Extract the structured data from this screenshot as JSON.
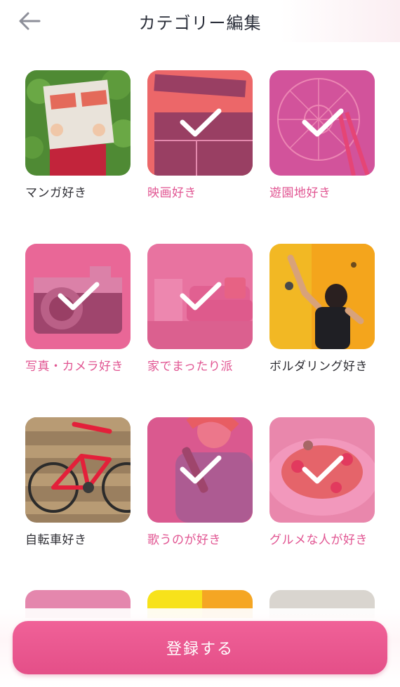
{
  "header": {
    "title": "カテゴリー編集",
    "back_icon": "arrow-left-icon"
  },
  "categories": [
    {
      "label": "マンガ好き",
      "selected": false,
      "image": "comic-book-photo"
    },
    {
      "label": "映画好き",
      "selected": true,
      "image": "clapperboard-photo"
    },
    {
      "label": "遊園地好き",
      "selected": true,
      "image": "ferris-wheel-photo"
    },
    {
      "label": "写真・カメラ好き",
      "selected": true,
      "image": "camera-photo"
    },
    {
      "label": "家でまったり派",
      "selected": true,
      "image": "living-room-photo"
    },
    {
      "label": "ボルダリング好き",
      "selected": false,
      "image": "climbing-wall-photo"
    },
    {
      "label": "自転車好き",
      "selected": false,
      "image": "red-bicycle-photo"
    },
    {
      "label": "歌うのが好き",
      "selected": true,
      "image": "singer-microphone-photo"
    },
    {
      "label": "グルメな人が好き",
      "selected": true,
      "image": "pasta-dish-photo"
    }
  ],
  "footer": {
    "submit_label": "登録する"
  },
  "colors": {
    "accent": "#e94e8c",
    "selected_label": "#e15592",
    "title_text": "#2b2f3a"
  }
}
